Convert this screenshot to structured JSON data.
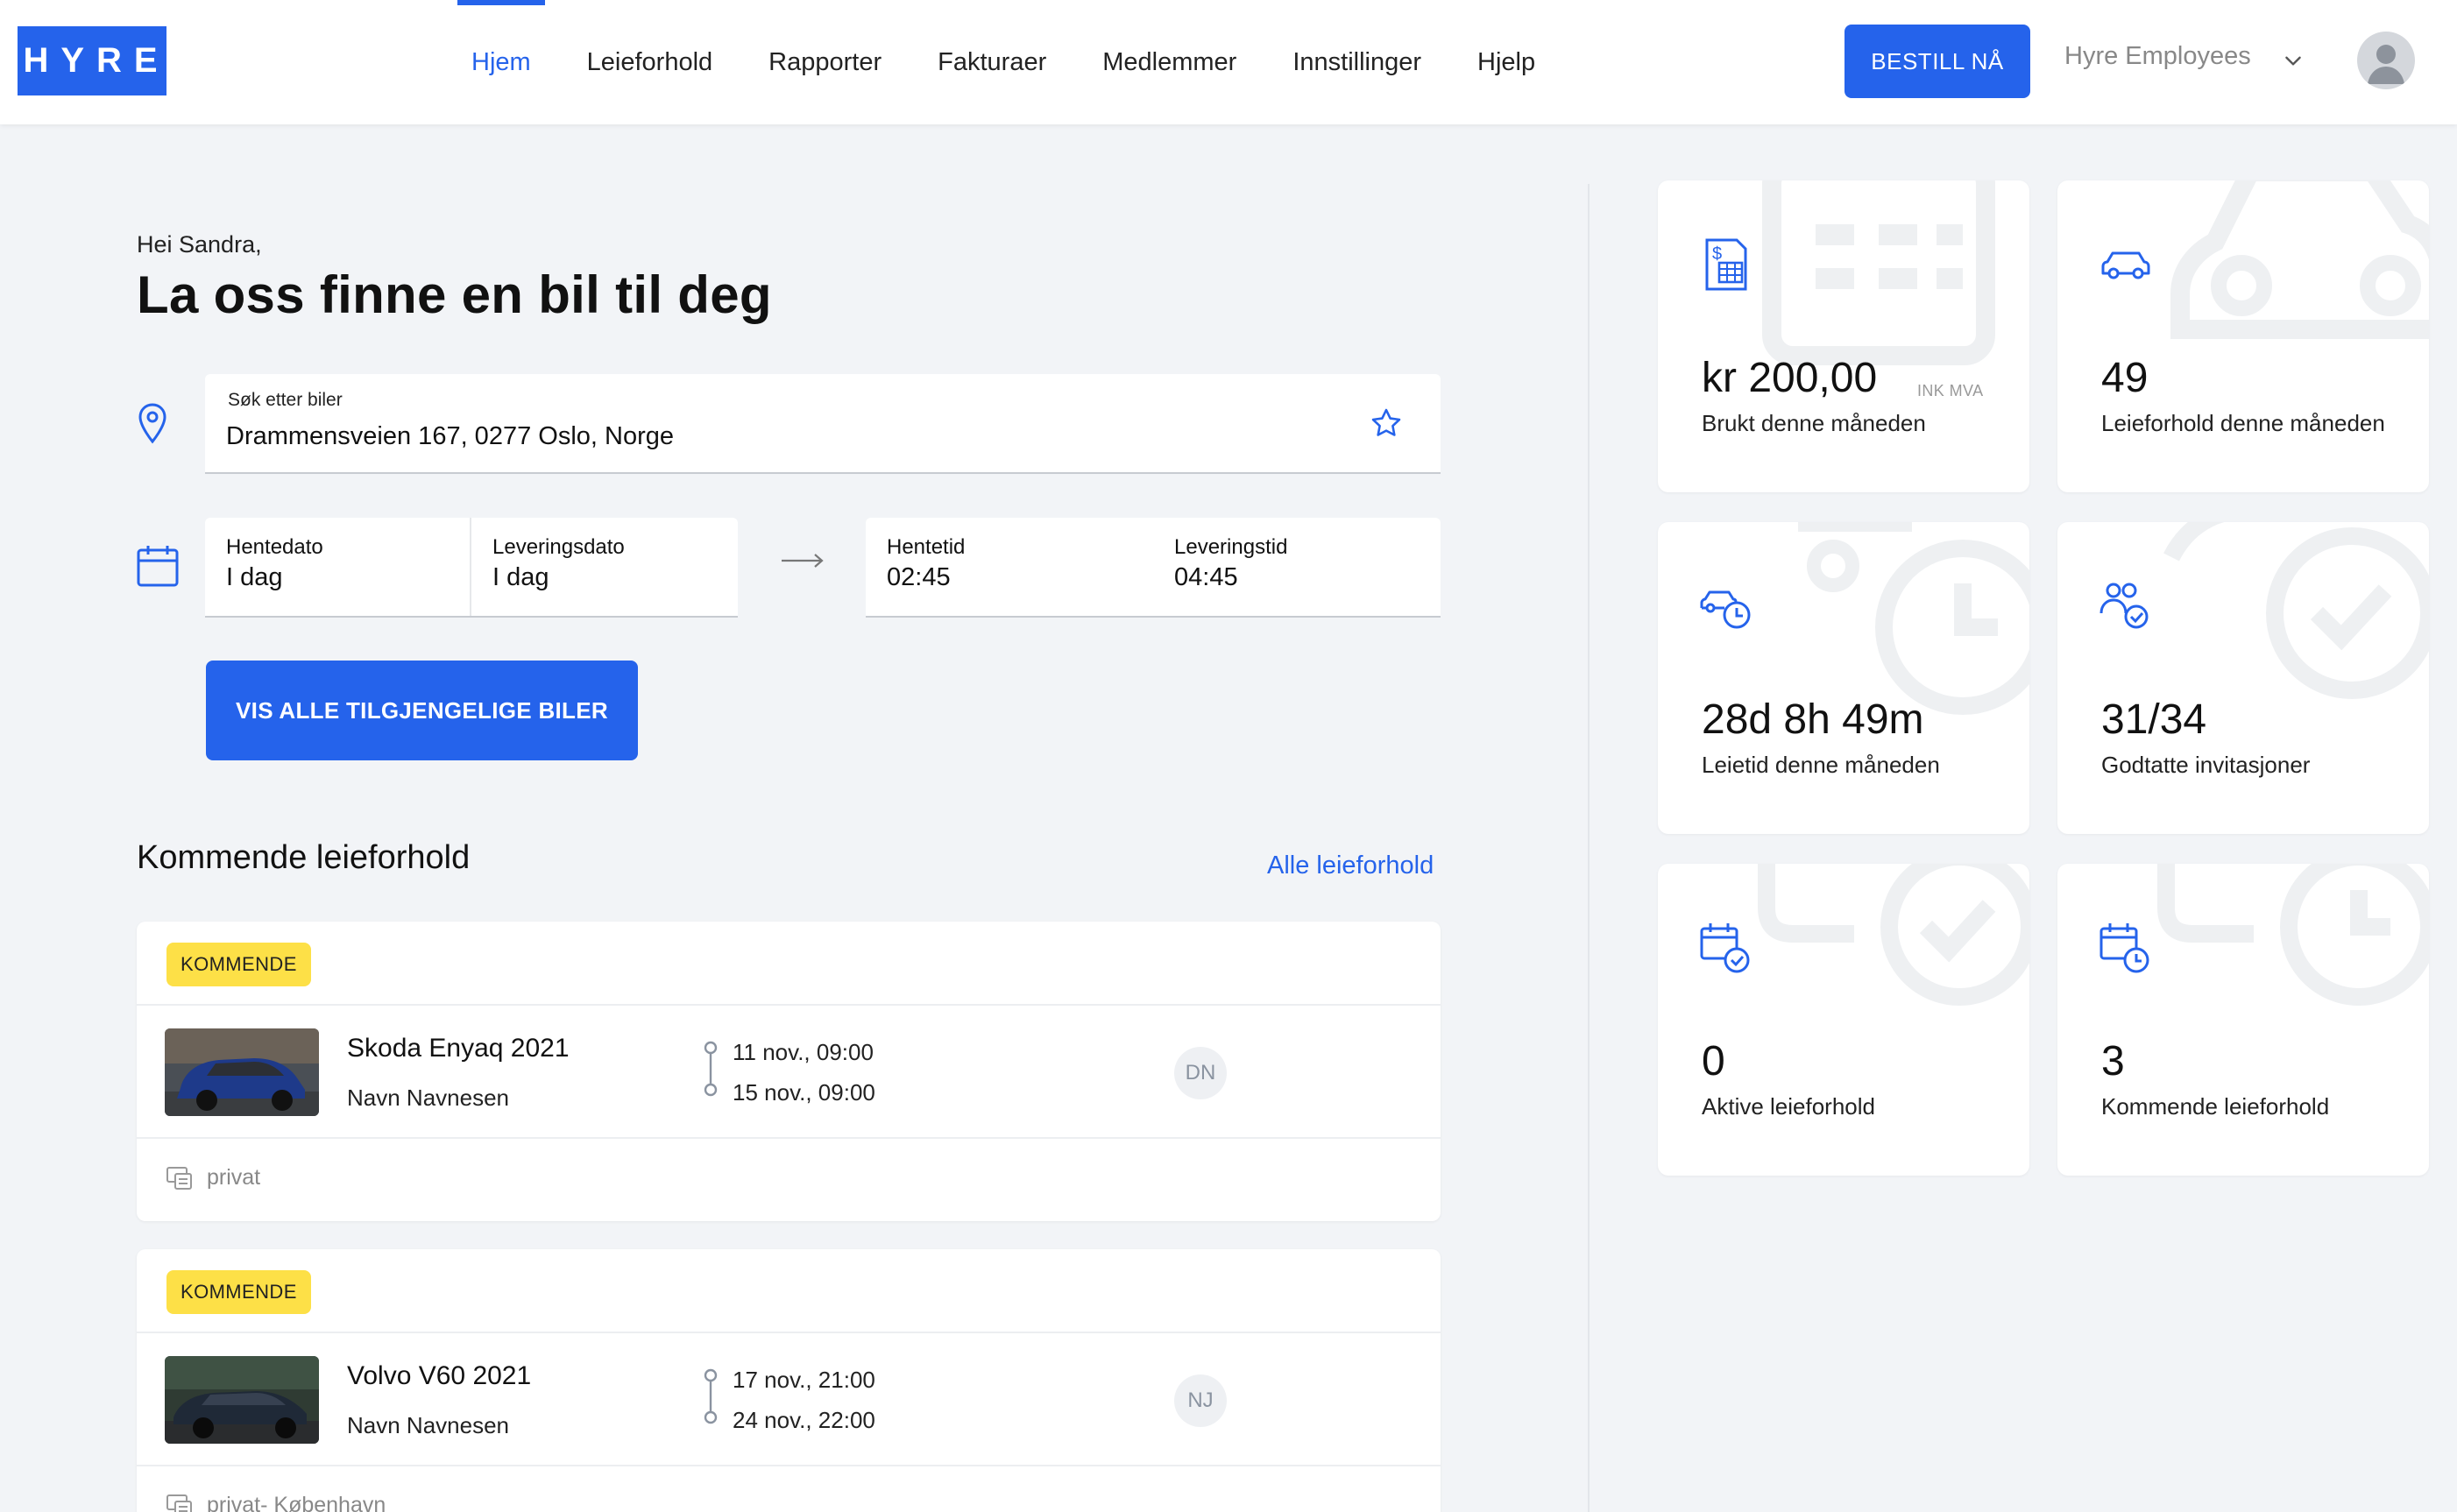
{
  "header": {
    "logo_text": "HYRE",
    "nav": [
      {
        "label": "Hjem",
        "active": true
      },
      {
        "label": "Leieforhold"
      },
      {
        "label": "Rapporter"
      },
      {
        "label": "Fakturaer"
      },
      {
        "label": "Medlemmer"
      },
      {
        "label": "Innstillinger"
      },
      {
        "label": "Hjelp"
      }
    ],
    "order_button": "BESTILL NÅ",
    "company": "Hyre Employees"
  },
  "search": {
    "greeting": "Hei Sandra,",
    "headline": "La oss finne en bil til deg",
    "location_label": "Søk etter biler",
    "location_value": "Drammensveien 167, 0277 Oslo, Norge",
    "pickup_date_label": "Hentedato",
    "pickup_date_value": "I dag",
    "delivery_date_label": "Leveringsdato",
    "delivery_date_value": "I dag",
    "pickup_time_label": "Hentetid",
    "pickup_time_value": "02:45",
    "delivery_time_label": "Leveringstid",
    "delivery_time_value": "04:45",
    "cta": "VIS ALLE TILGJENGELIGE BILER"
  },
  "upcoming": {
    "title": "Kommende leieforhold",
    "link": "Alle leieforhold",
    "bookings": [
      {
        "status": "KOMMENDE",
        "car": "Skoda Enyaq 2021",
        "driver": "Navn Navnesen",
        "start": "11 nov., 09:00",
        "end": "15 nov., 09:00",
        "initials": "DN",
        "tag": "privat",
        "car_color": "#1e3a8a"
      },
      {
        "status": "KOMMENDE",
        "car": "Volvo V60 2021",
        "driver": "Navn Navnesen",
        "start": "17 nov., 21:00",
        "end": "24 nov., 22:00",
        "initials": "NJ",
        "tag": "privat- København",
        "car_color": "#1f2937"
      }
    ]
  },
  "stats": [
    {
      "icon": "invoice-icon",
      "value": "kr 200,00",
      "sub": "INK MVA",
      "label": "Brukt denne måneden"
    },
    {
      "icon": "car-icon",
      "value": "49",
      "label": "Leieforhold denne måneden"
    },
    {
      "icon": "car-clock-icon",
      "value": "28d 8h 49m",
      "label": "Leietid denne måneden"
    },
    {
      "icon": "users-check-icon",
      "value": "31/34",
      "label": "Godtatte invitasjoner"
    },
    {
      "icon": "calendar-check-icon",
      "value": "0",
      "label": "Aktive leieforhold"
    },
    {
      "icon": "calendar-clock-icon",
      "value": "3",
      "label": "Kommende leieforhold"
    }
  ],
  "colors": {
    "accent": "#2563eb",
    "badge": "#fde047",
    "background": "#f2f4f7"
  }
}
